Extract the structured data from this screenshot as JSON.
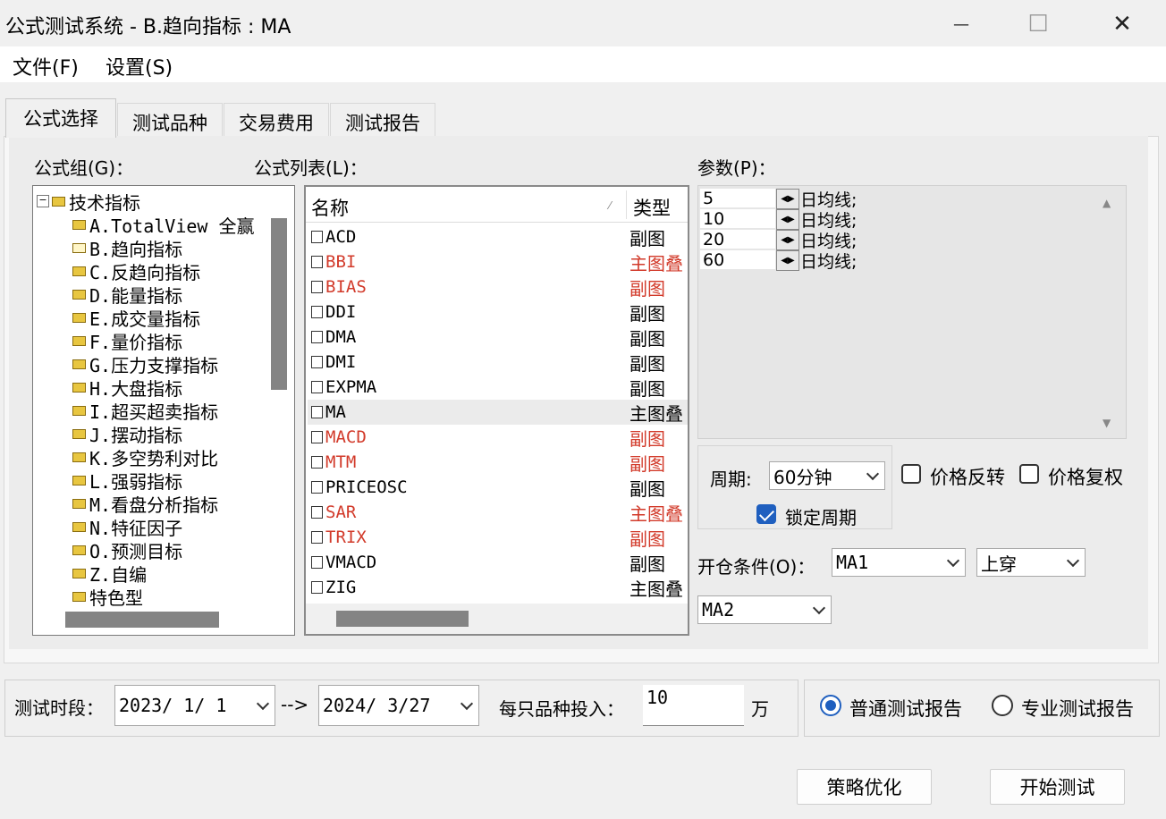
{
  "window": {
    "title": "公式测试系统 - B.趋向指标 : MA",
    "minimize_glyph": "—",
    "maximize_glyph": "☐",
    "close_glyph": "✕"
  },
  "menu": [
    "文件(F)",
    "设置(S)"
  ],
  "tabs": [
    "公式选择",
    "测试品种",
    "交易费用",
    "测试报告"
  ],
  "formula_group": {
    "label": "公式组(G)：",
    "root": "技术指标",
    "items": [
      "A.TotalView 全赢",
      "B.趋向指标",
      "C.反趋向指标",
      "D.能量指标",
      "E.成交量指标",
      "F.量价指标",
      "G.压力支撑指标",
      "H.大盘指标",
      "I.超买超卖指标",
      "J.摆动指标",
      "K.多空势利对比",
      "L.强弱指标",
      "M.看盘分析指标",
      "N.特征因子",
      "O.预测目标",
      "Z.自编",
      "特色型"
    ]
  },
  "formula_list": {
    "label": "公式列表(L)：",
    "headers": [
      "名称",
      "类型"
    ],
    "rows": [
      {
        "name": "ACD",
        "type": "副图",
        "red": false
      },
      {
        "name": "BBI",
        "type": "主图叠",
        "red": true
      },
      {
        "name": "BIAS",
        "type": "副图",
        "red": true
      },
      {
        "name": "DDI",
        "type": "副图",
        "red": false
      },
      {
        "name": "DMA",
        "type": "副图",
        "red": false
      },
      {
        "name": "DMI",
        "type": "副图",
        "red": false
      },
      {
        "name": "EXPMA",
        "type": "副图",
        "red": false
      },
      {
        "name": "MA",
        "type": "主图叠",
        "red": false,
        "selected": true
      },
      {
        "name": "MACD",
        "type": "副图",
        "red": true
      },
      {
        "name": "MTM",
        "type": "副图",
        "red": true
      },
      {
        "name": "PRICEOSC",
        "type": "副图",
        "red": false
      },
      {
        "name": "SAR",
        "type": "主图叠",
        "red": true
      },
      {
        "name": "TRIX",
        "type": "副图",
        "red": true
      },
      {
        "name": "VMACD",
        "type": "副图",
        "red": false
      },
      {
        "name": "ZIG",
        "type": "主图叠",
        "red": false
      }
    ]
  },
  "params": {
    "label": "参数(P)：",
    "rows": [
      {
        "value": "5",
        "suffix": "日均线;"
      },
      {
        "value": "10",
        "suffix": "日均线;"
      },
      {
        "value": "20",
        "suffix": "日均线;"
      },
      {
        "value": "60",
        "suffix": "日均线;"
      }
    ],
    "spin_glyph": "◀▶"
  },
  "period": {
    "label": "周期:",
    "value": "60分钟",
    "lock_label": "锁定周期",
    "lock_checked": true
  },
  "price_reverse": {
    "label": "价格反转",
    "checked": false
  },
  "price_adjust": {
    "label": "价格复权",
    "checked": false
  },
  "open_condition": {
    "label": "开仓条件(O)：",
    "field1": "MA1",
    "op": "上穿",
    "field2": "MA2"
  },
  "test_period": {
    "label": "测试时段：",
    "start": "2023/ 1/ 1",
    "arrow": "-->",
    "end": "2024/ 3/27"
  },
  "investment": {
    "label": "每只品种投入：",
    "value": "10",
    "unit": "万"
  },
  "report": {
    "normal": "普通测试报告",
    "pro": "专业测试报告",
    "selected": "normal"
  },
  "buttons": {
    "optimize": "策略优化",
    "start": "开始测试"
  },
  "colors": {
    "accent": "#1f5fbf",
    "red_text": "#d23a2a"
  }
}
